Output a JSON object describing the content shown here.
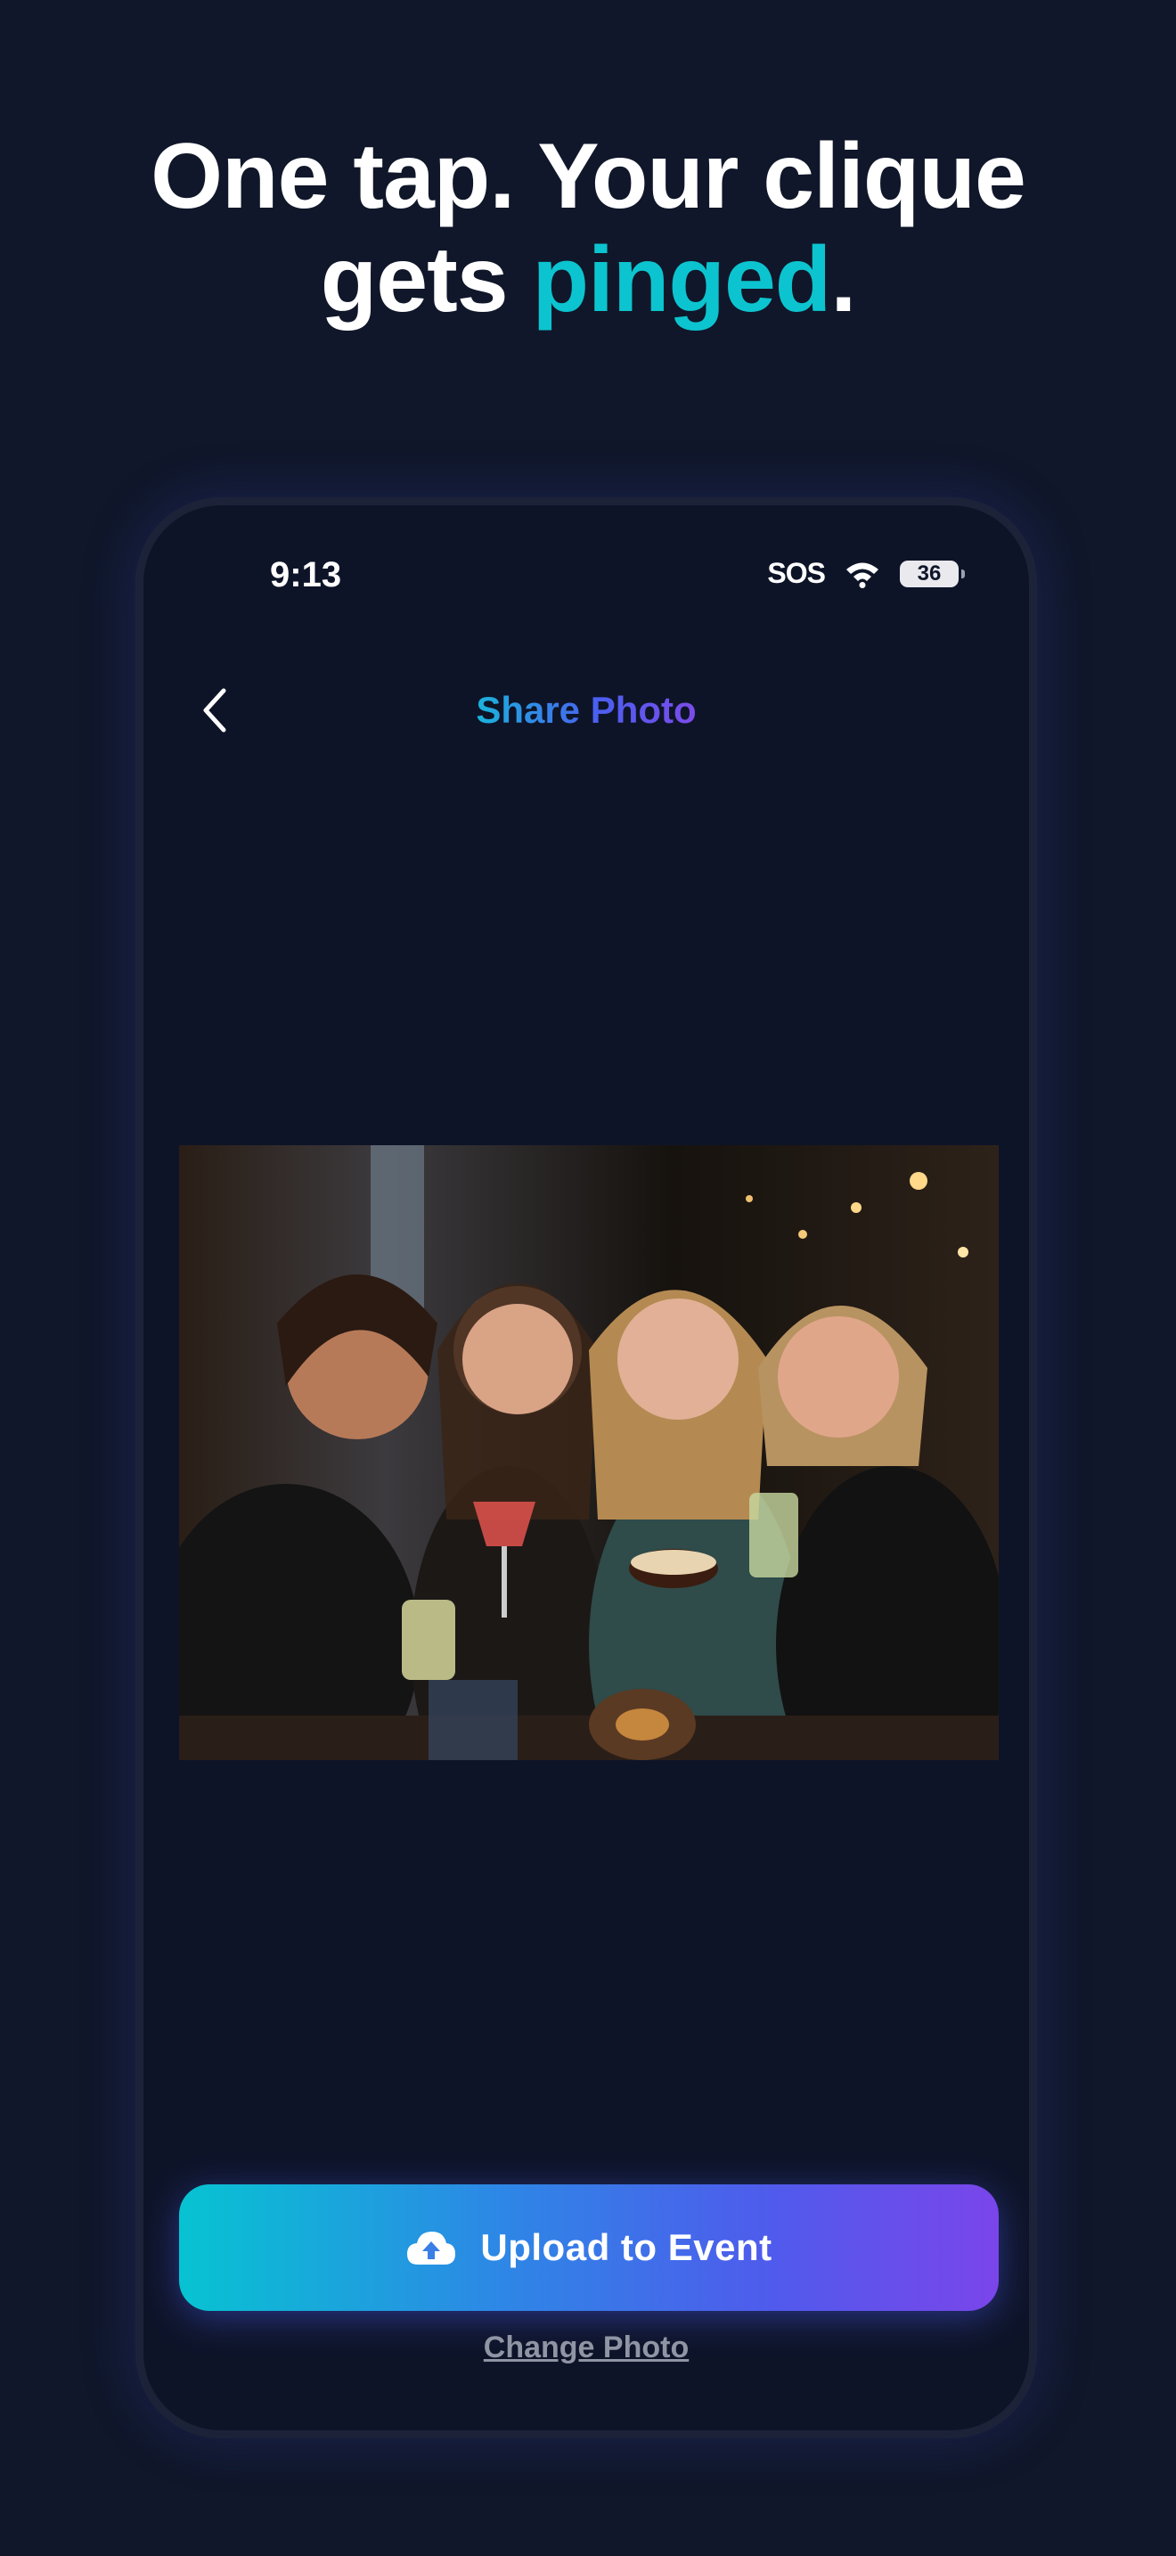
{
  "headline": {
    "line1": "One tap.  Your clique",
    "line2_prefix": "gets ",
    "line2_accent": "pinged",
    "line2_suffix": "."
  },
  "status_bar": {
    "time": "9:13",
    "carrier": "SOS",
    "battery": "36"
  },
  "nav": {
    "title": "Share Photo",
    "back_icon": "chevron-left-icon"
  },
  "photo": {
    "description_icon": "photo"
  },
  "actions": {
    "upload_label": "Upload to Event",
    "upload_icon": "cloud-upload-icon",
    "change_photo_label": "Change Photo"
  },
  "colors": {
    "background": "#10172a",
    "accent": "#0cc4cf",
    "gradient_start": "#07c3d2",
    "gradient_end": "#7a45ea"
  }
}
